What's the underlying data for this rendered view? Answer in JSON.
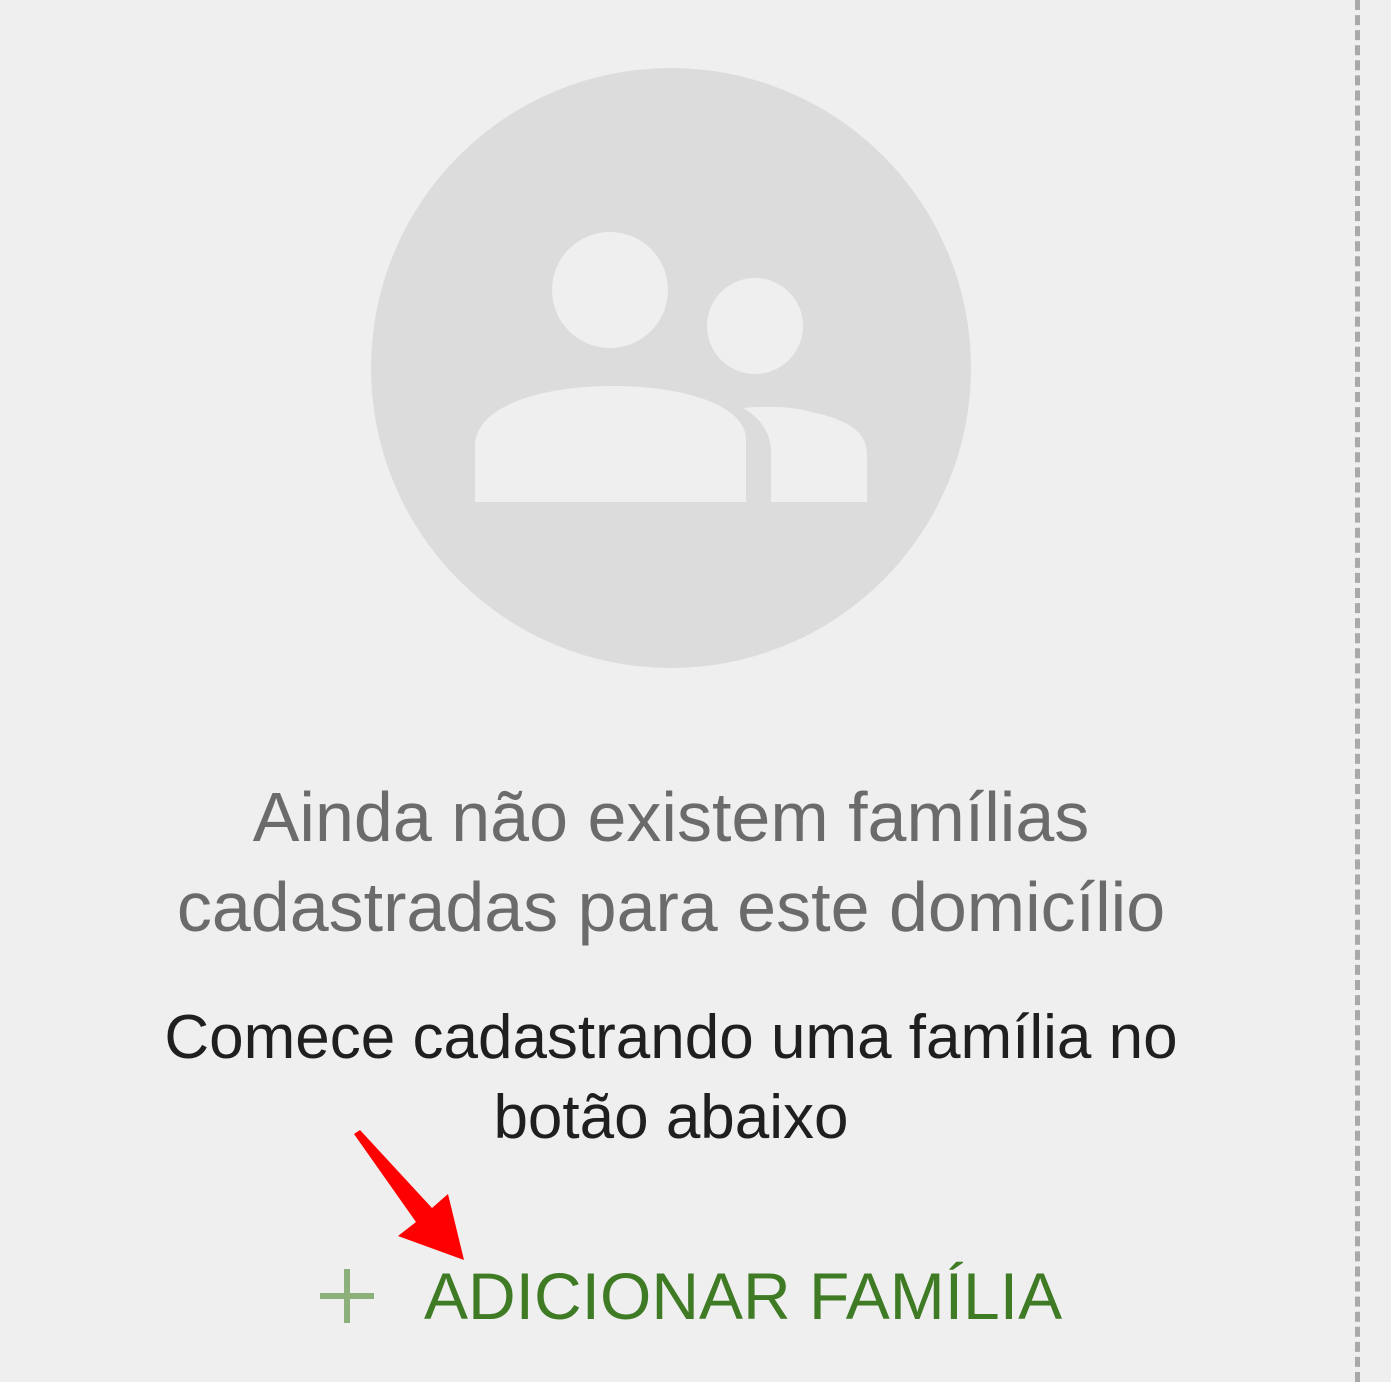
{
  "empty_state": {
    "title_line1": "Ainda não existem famílias",
    "title_line2": "cadastradas para este domicílio",
    "subtitle_line1": "Comece cadastrando uma família no",
    "subtitle_line2": "botão abaixo",
    "illustration_icon": "group-icon"
  },
  "actions": {
    "add_family_label": "ADICIONAR FAMÍLIA",
    "add_icon": "plus-icon"
  },
  "annotation": {
    "arrow_icon": "red-arrow-icon"
  },
  "colors": {
    "background": "#efefef",
    "illustration_circle": "#dcdcdc",
    "illustration_figure": "#efefef",
    "title_text": "#6b6b6b",
    "subtitle_text": "#1f1f1f",
    "action_text": "#3f7b24",
    "action_icon": "#8cb07c",
    "annotation_arrow": "#ff0000",
    "divider": "#a9a9a9"
  }
}
